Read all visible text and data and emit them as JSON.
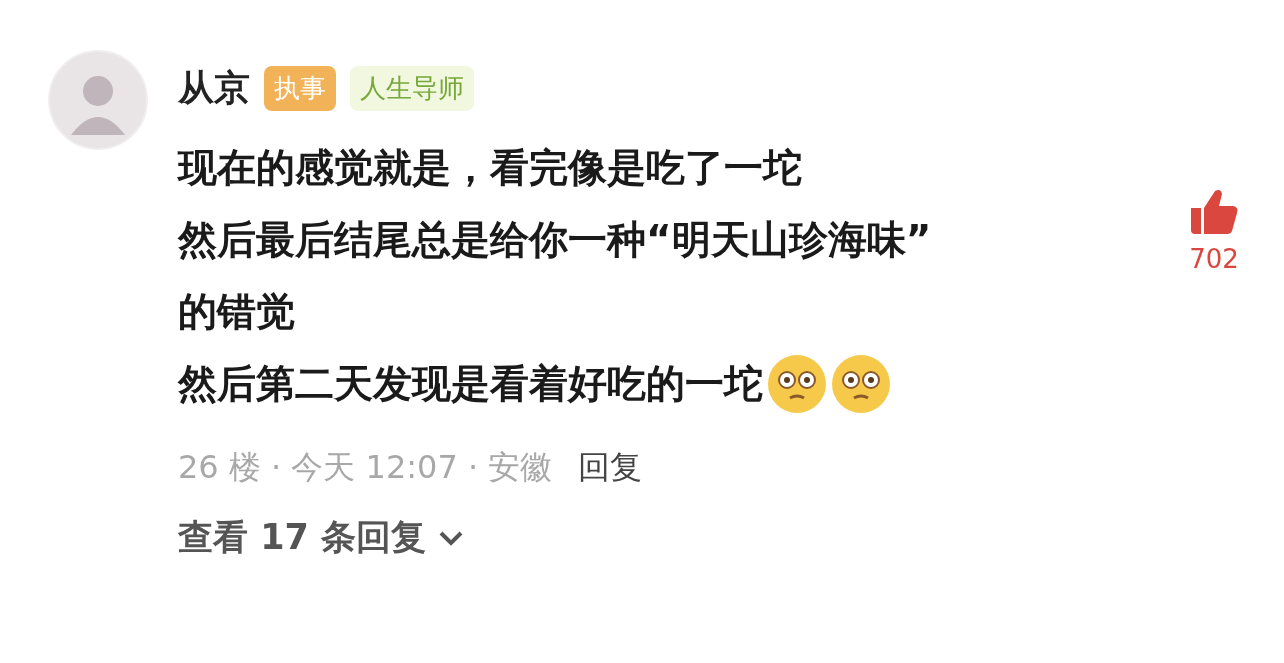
{
  "comment": {
    "author": "从京",
    "badges": [
      {
        "label": "执事",
        "kind": "role"
      },
      {
        "label": "人生导师",
        "kind": "title"
      }
    ],
    "lines": [
      "现在的感觉就是，看完像是吃了一坨",
      "然后最后结尾总是给你一种“明天山珍海味”",
      "的错觉",
      "然后第二天发现是看着好吃的一坨"
    ],
    "emojis": [
      {
        "kind": "flushed"
      },
      {
        "kind": "flushed"
      }
    ],
    "likes": {
      "count": "702",
      "liked": true
    },
    "meta": "26 楼 · 今天 12:07 · 安徽",
    "reply": "回复",
    "view_replies": "查看 17 条回复"
  }
}
